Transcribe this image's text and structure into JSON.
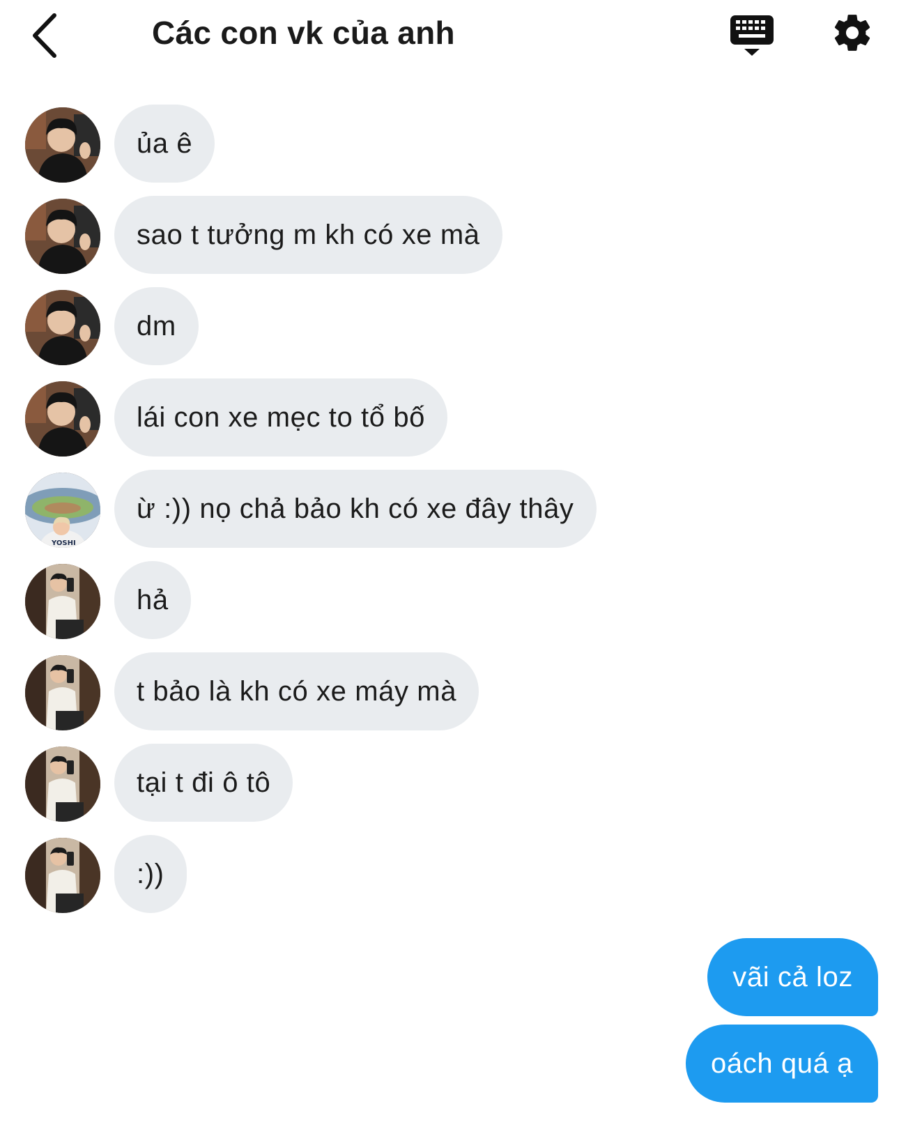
{
  "header": {
    "title": "Các con vk của anh",
    "back_icon": "chevron-left-icon",
    "keyboard_icon": "keyboard-icon",
    "settings_icon": "gear-icon"
  },
  "colors": {
    "incoming_bubble": "#e9ecef",
    "outgoing_bubble": "#1d9bf0",
    "text": "#1b1b1b"
  },
  "messages": [
    {
      "sender": "avatar-1",
      "text": "ủa ê"
    },
    {
      "sender": "avatar-1",
      "text": "sao t tưởng m kh có xe mà"
    },
    {
      "sender": "avatar-1",
      "text": "dm"
    },
    {
      "sender": "avatar-1",
      "text": "lái con xe mẹc to tổ bố"
    },
    {
      "sender": "avatar-2",
      "text": "ừ :)) nọ chả bảo kh có xe đây thây"
    },
    {
      "sender": "avatar-3",
      "text": "hả"
    },
    {
      "sender": "avatar-3",
      "text": "t bảo là kh có xe máy mà"
    },
    {
      "sender": "avatar-3",
      "text": "tại t đi ô tô"
    },
    {
      "sender": "avatar-3",
      "text": ":))"
    }
  ],
  "outgoing": [
    {
      "text": "vãi cả loz"
    },
    {
      "text": "oách quá ạ"
    }
  ],
  "avatar_2_jersey": "YOSHI"
}
